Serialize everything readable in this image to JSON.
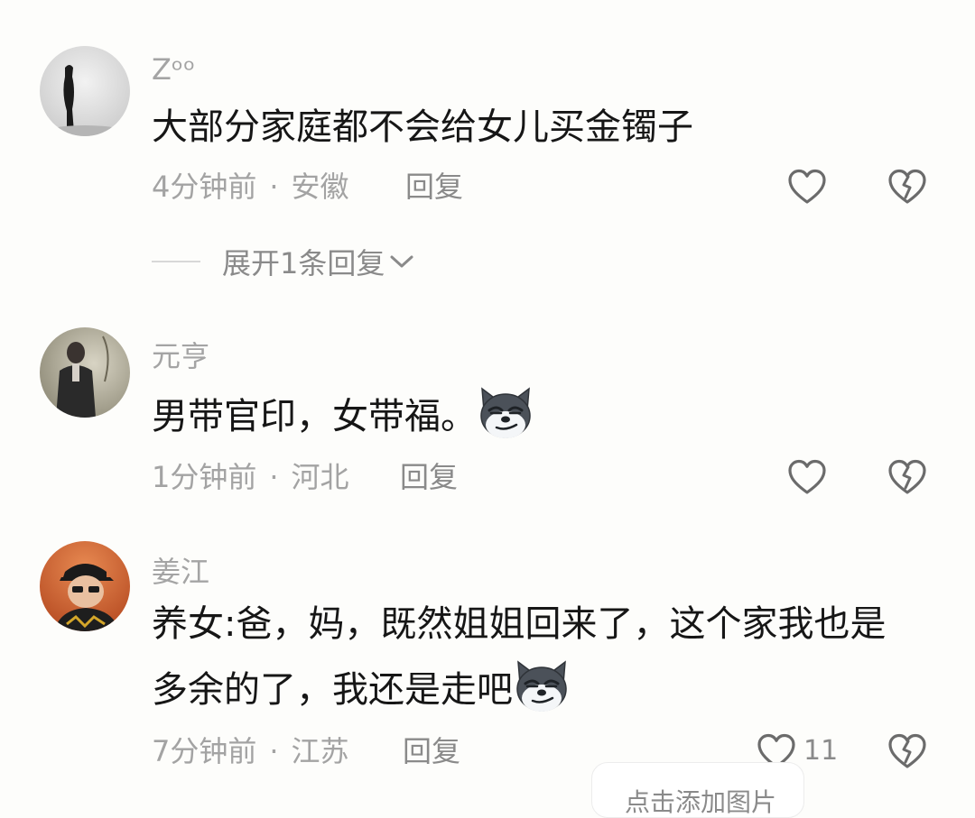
{
  "comments": [
    {
      "username": "Zᵒᵒ",
      "text_lines": [
        "大部分家庭都不会给女儿买金镯子"
      ],
      "time": "4分钟前",
      "location": "安徽",
      "reply_label": "回复",
      "like_count": "",
      "expand_label": "展开1条回复"
    },
    {
      "username": "元亨",
      "text_lines": [
        "男带官印，女带福。"
      ],
      "time": "1分钟前",
      "location": "河北",
      "reply_label": "回复",
      "like_count": ""
    },
    {
      "username": "姜江",
      "text_lines": [
        "养女:爸，妈，既然姐姐回来了，这个家我也是",
        "多余的了，我还是走吧"
      ],
      "time": "7分钟前",
      "location": "江苏",
      "reply_label": "回复",
      "like_count": "11"
    }
  ],
  "separator": "·",
  "input_hint": "点击添加图片",
  "icons": {
    "like": "heart-outline-icon",
    "dislike": "broken-heart-icon",
    "expand": "chevron-down-icon",
    "emoji": "dog-smirk-emoji"
  },
  "colors": {
    "background": "#fdfdfb",
    "text": "#161616",
    "muted": "#a3a3a3",
    "action": "#8a8a8a"
  }
}
